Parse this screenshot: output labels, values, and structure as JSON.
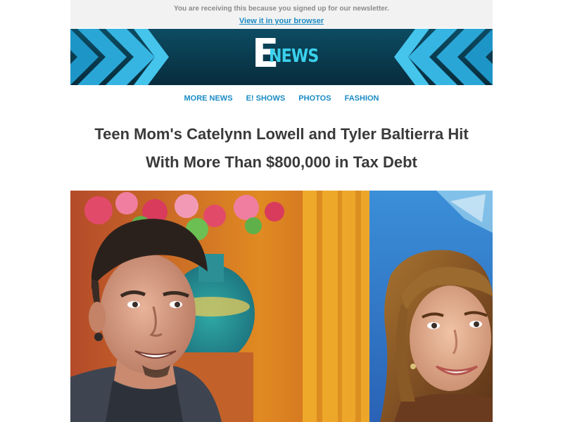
{
  "preheader": {
    "notice": "You are receiving this because you signed up for our newsletter.",
    "view_in_browser": "View it in your browser"
  },
  "brand": {
    "logo_letter": "E",
    "logo_word": "NEWS",
    "colors": {
      "banner": "#0a3a4d",
      "accent": "#3ad0ec",
      "link": "#1a8bc4"
    }
  },
  "nav": {
    "items": [
      "MORE NEWS",
      "E! SHOWS",
      "PHOTOS",
      "FASHION"
    ]
  },
  "article": {
    "headline": "Teen Mom's Catelynn Lowell and Tyler Baltierra Hit With More Than $800,000 in Tax Debt",
    "hero_image": "photo of a smiling couple on a talk-show set"
  }
}
